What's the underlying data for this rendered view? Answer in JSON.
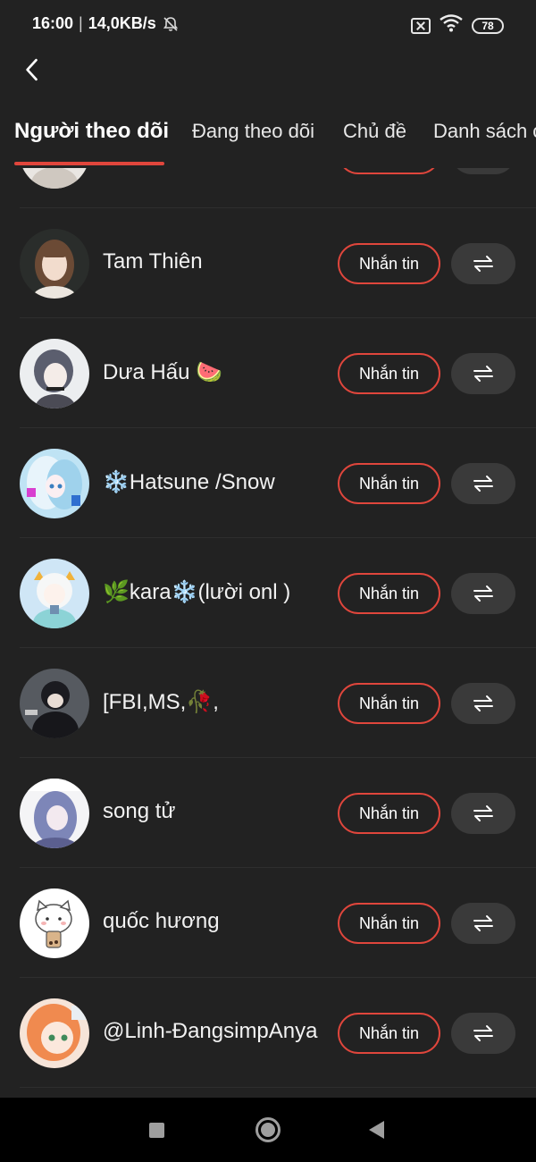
{
  "status_bar": {
    "time": "16:00",
    "separator": "|",
    "net_speed": "14,0KB/s",
    "battery": "78",
    "icons": [
      "bell-off-icon",
      "sim-x-icon",
      "wifi-icon",
      "battery-icon"
    ]
  },
  "header": {
    "back_icon": "chevron-left-icon"
  },
  "tabs": [
    {
      "label": "Người theo dõi",
      "active": true
    },
    {
      "label": "Đang theo dõi",
      "active": false
    },
    {
      "label": "Chủ đề",
      "active": false
    },
    {
      "label": "Danh sách c",
      "active": false
    }
  ],
  "colors": {
    "accent": "#e0463c",
    "background": "#222222",
    "pill": "#3a3a3a",
    "nav_bar": "#000000"
  },
  "list": {
    "items": [
      {
        "name": "",
        "message_label": "",
        "partial": true
      },
      {
        "name": "Tam Thiên",
        "message_label": "Nhắn tin"
      },
      {
        "name": "Dưa Hấu 🍉",
        "message_label": "Nhắn tin"
      },
      {
        "name": "❄️Hatsune /Snow",
        "message_label": "Nhắn tin"
      },
      {
        "name": "🌿kara❄️(lười onl )",
        "message_label": "Nhắn tin"
      },
      {
        "name": "[FBI,MS,🥀,",
        "message_label": "Nhắn tin"
      },
      {
        "name": "song tử",
        "message_label": "Nhắn tin"
      },
      {
        "name": "quốc hương",
        "message_label": "Nhắn tin"
      },
      {
        "name": "@Linh-ĐangsimpAnya",
        "message_label": "Nhắn tin"
      }
    ],
    "switch_icon": "swap-arrows-icon"
  },
  "nav_bar": {
    "icons": [
      "recents-square-icon",
      "home-circle-icon",
      "back-triangle-icon"
    ]
  }
}
